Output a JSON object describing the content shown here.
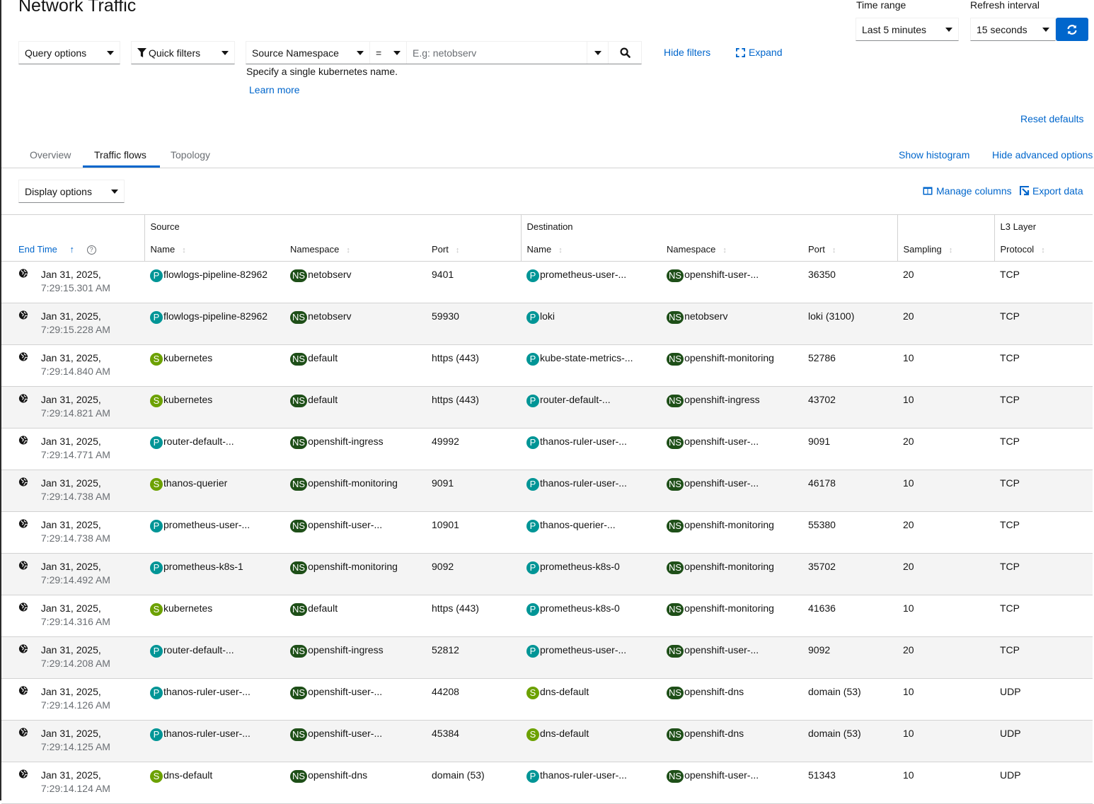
{
  "page": {
    "title": "Network Traffic"
  },
  "toolbar": {
    "query_options": "Query options",
    "quick_filters": "Quick filters",
    "filter_field": "Source Namespace",
    "filter_operator": "=",
    "filter_placeholder": "E.g: netobserv",
    "filter_value": "",
    "helper_text": "Specify a single kubernetes name.",
    "learn_more": "Learn more",
    "hide_filters": "Hide filters",
    "expand": "Expand",
    "reset_defaults": "Reset defaults",
    "time_range_label": "Time range",
    "time_range_value": "Last 5 minutes",
    "refresh_label": "Refresh interval",
    "refresh_value": "15 seconds"
  },
  "tabs": [
    {
      "label": "Overview",
      "active": false
    },
    {
      "label": "Traffic flows",
      "active": true
    },
    {
      "label": "Topology",
      "active": false
    }
  ],
  "tab_actions": {
    "show_histogram": "Show histogram",
    "hide_advanced": "Hide advanced options"
  },
  "display": {
    "display_options": "Display options",
    "manage_columns": "Manage columns",
    "export_data": "Export data"
  },
  "table": {
    "groups": {
      "source": "Source",
      "destination": "Destination",
      "l3": "L3 Layer"
    },
    "columns": {
      "end_time": "End Time",
      "src_name": "Name",
      "src_namespace": "Namespace",
      "src_port": "Port",
      "dst_name": "Name",
      "dst_namespace": "Namespace",
      "dst_port": "Port",
      "sampling": "Sampling",
      "protocol": "Protocol"
    },
    "rows": [
      {
        "date": "Jan 31, 2025,",
        "time": "7:29:15.301 AM",
        "src_kind": "P",
        "src_name": "flowlogs-pipeline-82962",
        "src_ns": "netobserv",
        "src_port": "9401",
        "dst_kind": "P",
        "dst_name": "prometheus-user-...",
        "dst_ns": "openshift-user-...",
        "dst_port": "36350",
        "sampling": "20",
        "protocol": "TCP"
      },
      {
        "date": "Jan 31, 2025,",
        "time": "7:29:15.228 AM",
        "src_kind": "P",
        "src_name": "flowlogs-pipeline-82962",
        "src_ns": "netobserv",
        "src_port": "59930",
        "dst_kind": "P",
        "dst_name": "loki",
        "dst_ns": "netobserv",
        "dst_port": "loki (3100)",
        "sampling": "20",
        "protocol": "TCP"
      },
      {
        "date": "Jan 31, 2025,",
        "time": "7:29:14.840 AM",
        "src_kind": "S",
        "src_name": "kubernetes",
        "src_ns": "default",
        "src_port": "https (443)",
        "dst_kind": "P",
        "dst_name": "kube-state-metrics-...",
        "dst_ns": "openshift-monitoring",
        "dst_port": "52786",
        "sampling": "10",
        "protocol": "TCP"
      },
      {
        "date": "Jan 31, 2025,",
        "time": "7:29:14.821 AM",
        "src_kind": "S",
        "src_name": "kubernetes",
        "src_ns": "default",
        "src_port": "https (443)",
        "dst_kind": "P",
        "dst_name": "router-default-...",
        "dst_ns": "openshift-ingress",
        "dst_port": "43702",
        "sampling": "10",
        "protocol": "TCP"
      },
      {
        "date": "Jan 31, 2025,",
        "time": "7:29:14.771 AM",
        "src_kind": "P",
        "src_name": "router-default-...",
        "src_ns": "openshift-ingress",
        "src_port": "49992",
        "dst_kind": "P",
        "dst_name": "thanos-ruler-user-...",
        "dst_ns": "openshift-user-...",
        "dst_port": "9091",
        "sampling": "20",
        "protocol": "TCP"
      },
      {
        "date": "Jan 31, 2025,",
        "time": "7:29:14.738 AM",
        "src_kind": "S",
        "src_name": "thanos-querier",
        "src_ns": "openshift-monitoring",
        "src_port": "9091",
        "dst_kind": "P",
        "dst_name": "thanos-ruler-user-...",
        "dst_ns": "openshift-user-...",
        "dst_port": "46178",
        "sampling": "10",
        "protocol": "TCP"
      },
      {
        "date": "Jan 31, 2025,",
        "time": "7:29:14.738 AM",
        "src_kind": "P",
        "src_name": "prometheus-user-...",
        "src_ns": "openshift-user-...",
        "src_port": "10901",
        "dst_kind": "P",
        "dst_name": "thanos-querier-...",
        "dst_ns": "openshift-monitoring",
        "dst_port": "55380",
        "sampling": "20",
        "protocol": "TCP"
      },
      {
        "date": "Jan 31, 2025,",
        "time": "7:29:14.492 AM",
        "src_kind": "P",
        "src_name": "prometheus-k8s-1",
        "src_ns": "openshift-monitoring",
        "src_port": "9092",
        "dst_kind": "P",
        "dst_name": "prometheus-k8s-0",
        "dst_ns": "openshift-monitoring",
        "dst_port": "35702",
        "sampling": "20",
        "protocol": "TCP"
      },
      {
        "date": "Jan 31, 2025,",
        "time": "7:29:14.316 AM",
        "src_kind": "S",
        "src_name": "kubernetes",
        "src_ns": "default",
        "src_port": "https (443)",
        "dst_kind": "P",
        "dst_name": "prometheus-k8s-0",
        "dst_ns": "openshift-monitoring",
        "dst_port": "41636",
        "sampling": "10",
        "protocol": "TCP"
      },
      {
        "date": "Jan 31, 2025,",
        "time": "7:29:14.208 AM",
        "src_kind": "P",
        "src_name": "router-default-...",
        "src_ns": "openshift-ingress",
        "src_port": "52812",
        "dst_kind": "P",
        "dst_name": "prometheus-user-...",
        "dst_ns": "openshift-user-...",
        "dst_port": "9092",
        "sampling": "20",
        "protocol": "TCP"
      },
      {
        "date": "Jan 31, 2025,",
        "time": "7:29:14.126 AM",
        "src_kind": "P",
        "src_name": "thanos-ruler-user-...",
        "src_ns": "openshift-user-...",
        "src_port": "44208",
        "dst_kind": "S",
        "dst_name": "dns-default",
        "dst_ns": "openshift-dns",
        "dst_port": "domain (53)",
        "sampling": "10",
        "protocol": "UDP"
      },
      {
        "date": "Jan 31, 2025,",
        "time": "7:29:14.125 AM",
        "src_kind": "P",
        "src_name": "thanos-ruler-user-...",
        "src_ns": "openshift-user-...",
        "src_port": "45384",
        "dst_kind": "S",
        "dst_name": "dns-default",
        "dst_ns": "openshift-dns",
        "dst_port": "domain (53)",
        "sampling": "10",
        "protocol": "UDP"
      },
      {
        "date": "Jan 31, 2025,",
        "time": "7:29:14.124 AM",
        "src_kind": "S",
        "src_name": "dns-default",
        "src_ns": "openshift-dns",
        "src_port": "domain (53)",
        "dst_kind": "P",
        "dst_name": "thanos-ruler-user-...",
        "dst_ns": "openshift-user-...",
        "dst_port": "51343",
        "sampling": "10",
        "protocol": "UDP"
      }
    ]
  },
  "icons": {
    "filter": "funnel-icon",
    "search": "search-icon",
    "expand": "expand-icon",
    "refresh": "sync-icon",
    "columns": "columns-icon",
    "export": "export-icon",
    "globe": "globe-icon",
    "help": "help-icon",
    "sort": "sort-icon",
    "sort_asc": "arrow-up-icon"
  },
  "colors": {
    "accent": "#0066cc",
    "pod_badge": "#009596",
    "service_badge": "#6ca100",
    "namespace_badge": "#1e4f18"
  }
}
